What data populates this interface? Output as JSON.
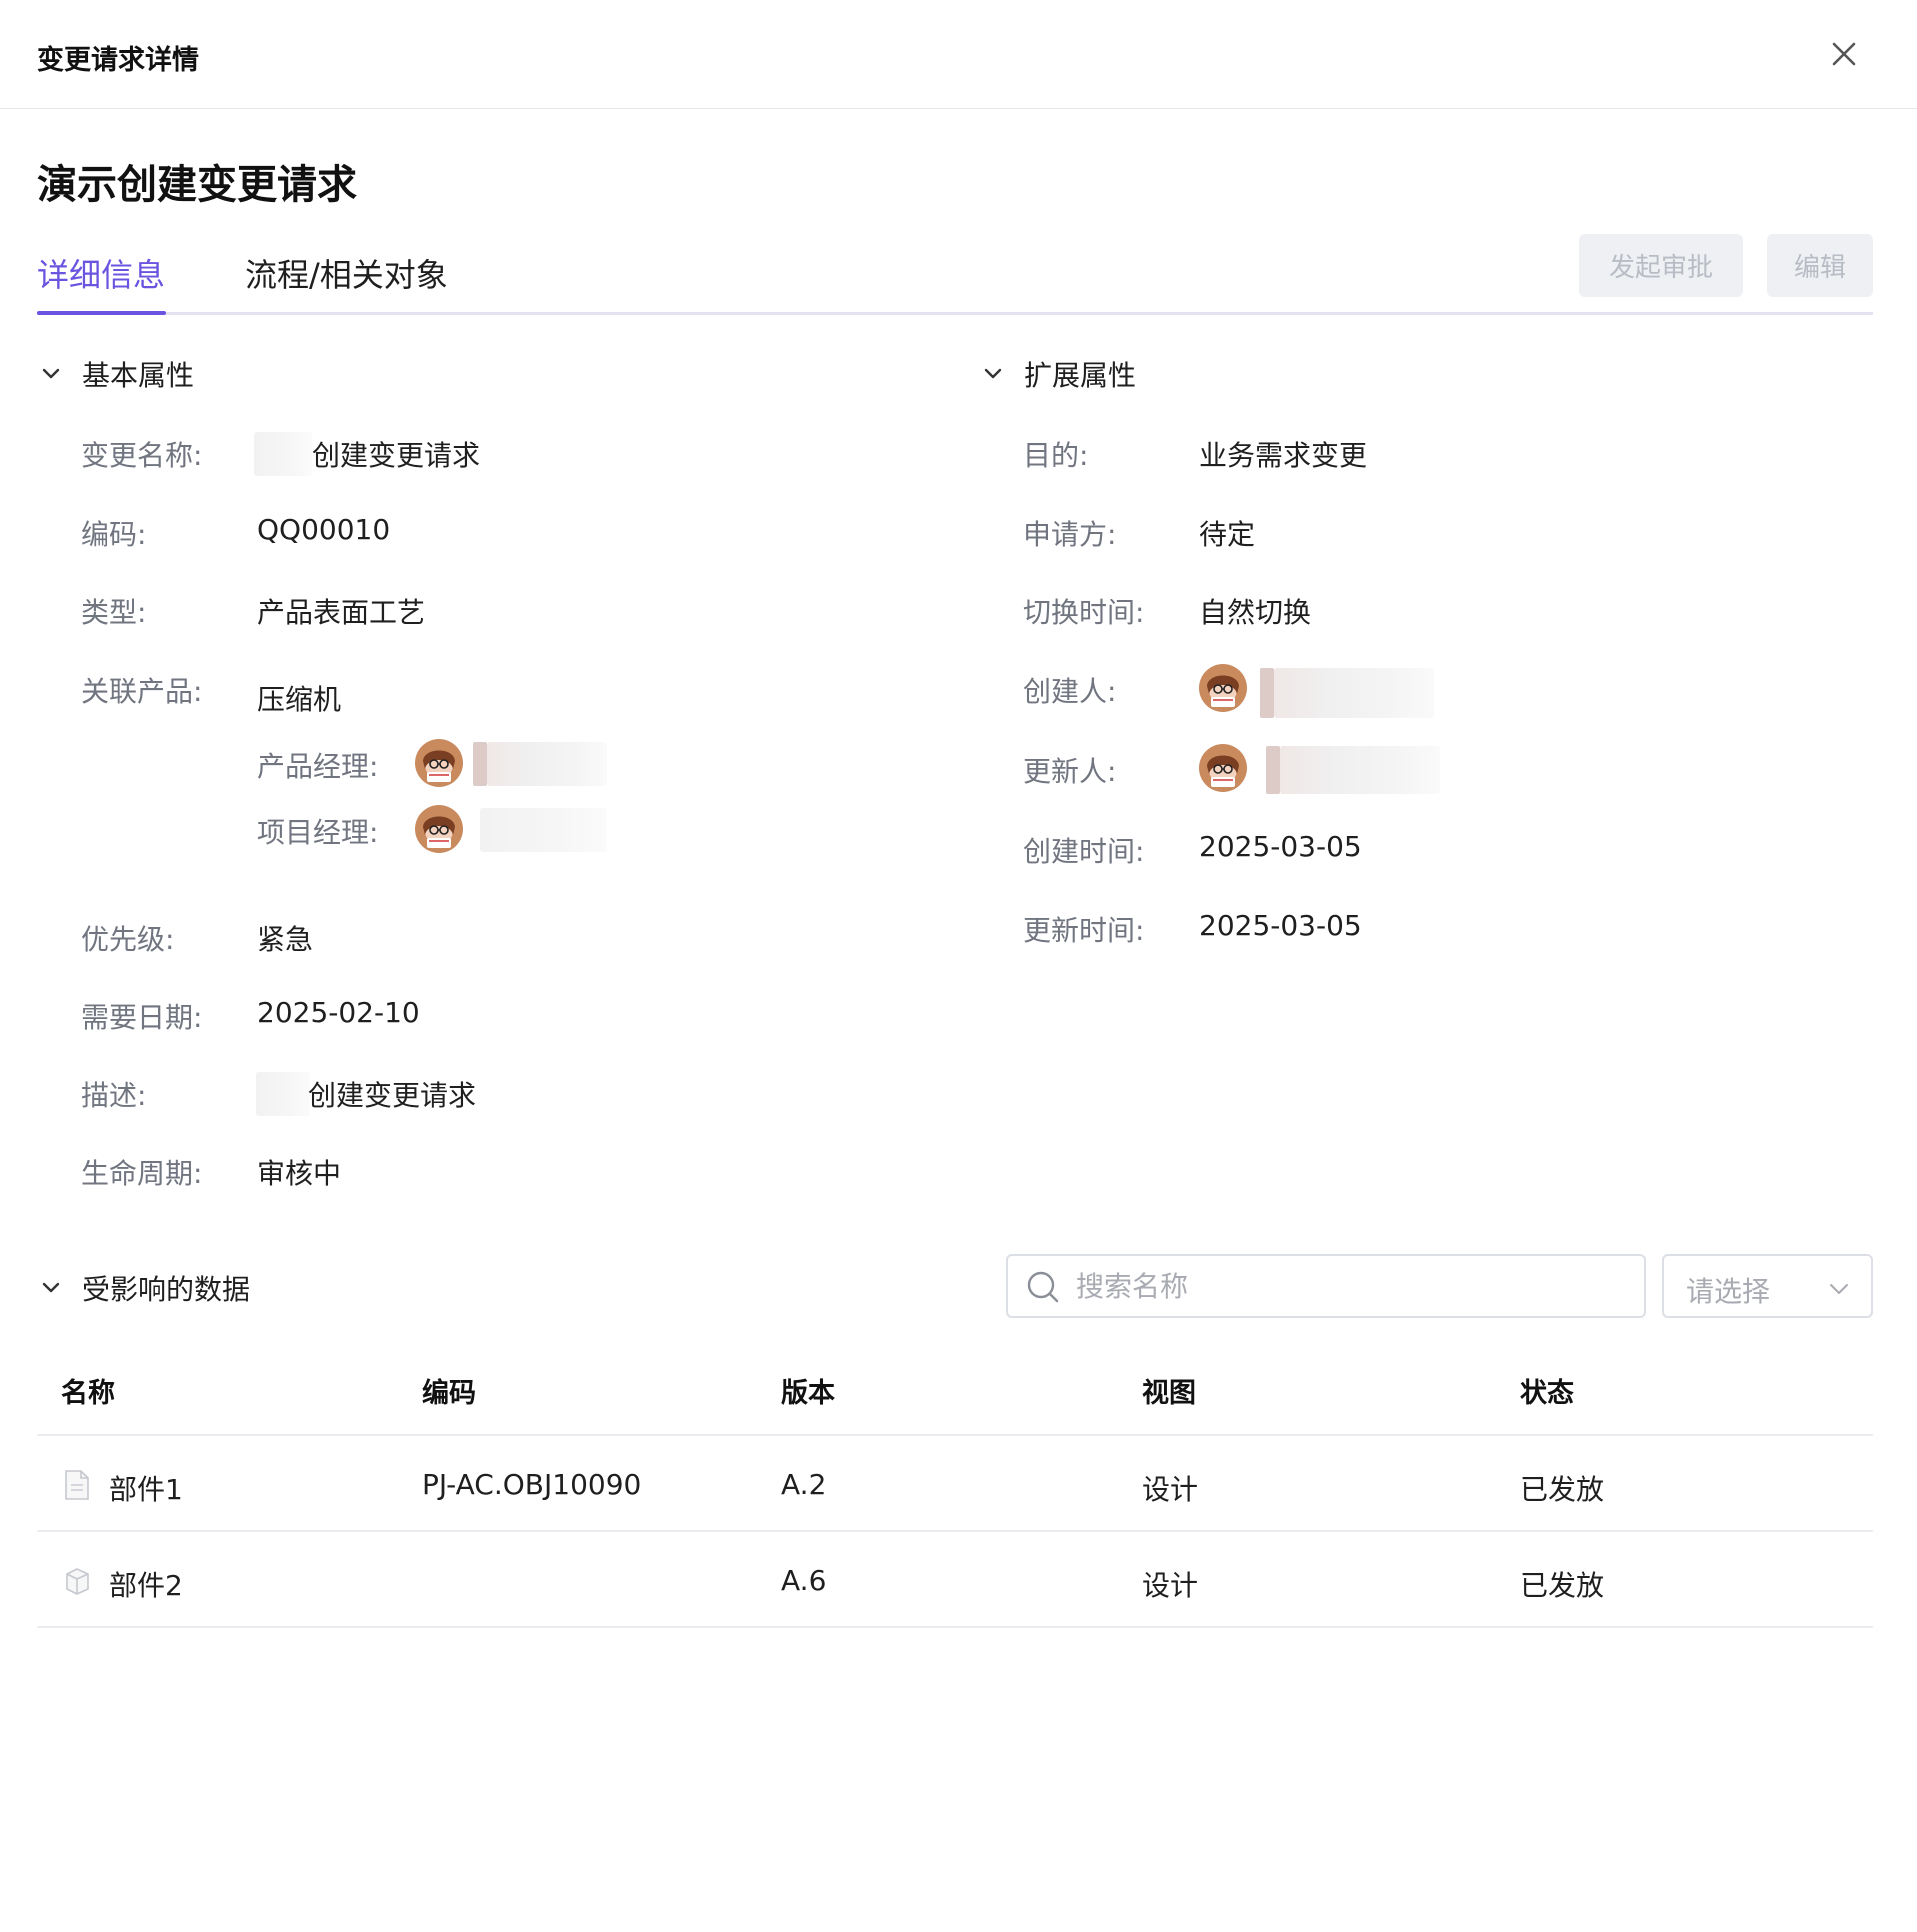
{
  "dialog": {
    "title": "变更请求详情"
  },
  "page": {
    "title": "演示创建变更请求"
  },
  "tabs": [
    {
      "label": "详细信息",
      "active": true
    },
    {
      "label": "流程/相关对象",
      "active": false
    }
  ],
  "actions": {
    "approve_label": "发起审批",
    "edit_label": "编辑"
  },
  "basic": {
    "heading": "基本属性",
    "change_name": {
      "label": "变更名称:",
      "value": "创建变更请求"
    },
    "code": {
      "label": "编码:",
      "value": "QQ00010"
    },
    "type": {
      "label": "类型:",
      "value": "产品表面工艺"
    },
    "product": {
      "label": "关联产品:",
      "value": "压缩机",
      "product_manager_label": "产品经理:",
      "project_manager_label": "项目经理:"
    },
    "priority": {
      "label": "优先级:",
      "value": "紧急"
    },
    "need_date": {
      "label": "需要日期:",
      "value": "2025-02-10"
    },
    "description": {
      "label": "描述:",
      "value": "创建变更请求"
    },
    "lifecycle": {
      "label": "生命周期:",
      "value": "审核中"
    }
  },
  "extended": {
    "heading": "扩展属性",
    "purpose": {
      "label": "目的:",
      "value": "业务需求变更"
    },
    "applicant": {
      "label": "申请方:",
      "value": "待定"
    },
    "switch_time": {
      "label": "切换时间:",
      "value": "自然切换"
    },
    "creator": {
      "label": "创建人:"
    },
    "updater": {
      "label": "更新人:"
    },
    "created_at": {
      "label": "创建时间:",
      "value": "2025-03-05"
    },
    "updated_at": {
      "label": "更新时间:",
      "value": "2025-03-05"
    }
  },
  "affected": {
    "heading": "受影响的数据",
    "search_placeholder": "搜索名称",
    "select_placeholder": "请选择",
    "columns": [
      "名称",
      "编码",
      "版本",
      "视图",
      "状态"
    ],
    "rows": [
      {
        "icon": "document-icon",
        "name": "部件1",
        "code": "PJ-AC.OBJ10090",
        "version": "A.2",
        "view": "设计",
        "status": "已发放"
      },
      {
        "icon": "cube-icon",
        "name": "部件2",
        "code": "",
        "version": "A.6",
        "view": "设计",
        "status": "已发放"
      }
    ]
  },
  "colors": {
    "accent": "#6a55e0",
    "label": "#707580",
    "disabled_button_bg": "#eef0f4"
  }
}
